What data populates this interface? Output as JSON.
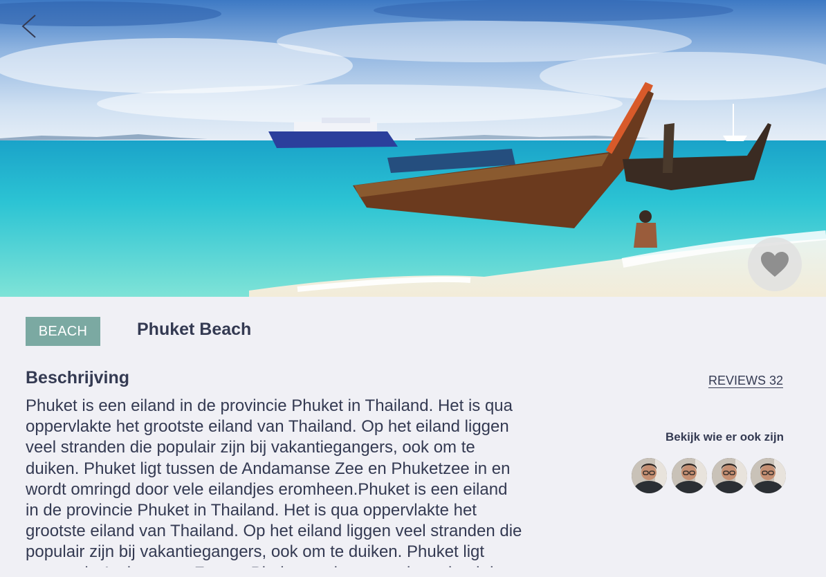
{
  "hero": {
    "image": "tropical beach with longtail boats",
    "back_icon": "chevron-left-icon",
    "favorite_icon": "heart-icon"
  },
  "place": {
    "category": "BEACH",
    "title": "Phuket Beach"
  },
  "description": {
    "heading": "Beschrijving",
    "text": "Phuket is een eiland in de provincie Phuket in Thailand. Het is qua oppervlakte het grootste eiland van Thailand. Op het eiland liggen veel stranden die populair zijn bij vakantiegangers, ook om te duiken. Phuket ligt tussen de Andamanse Zee en Phuketzee in en wordt omringd door vele eilandjes eromheen.Phuket is een eiland in de provincie Phuket in Thailand. Het is qua oppervlakte het grootste eiland van Thailand. Op het eiland liggen veel stranden die populair zijn bij vakantiegangers, ook om te duiken. Phuket ligt tussen de Andamanse Zee en Phuketzee in en wordt omringd door vele eilandjes eromheen."
  },
  "reviews": {
    "label": "REVIEWS 32"
  },
  "visitors": {
    "label": "Bekijk wie er ook zijn",
    "avatars": [
      "avatar",
      "avatar",
      "avatar",
      "avatar"
    ]
  },
  "colors": {
    "background": "#f0f0f5",
    "text": "#343a52",
    "badge": "#7ba9a2"
  }
}
